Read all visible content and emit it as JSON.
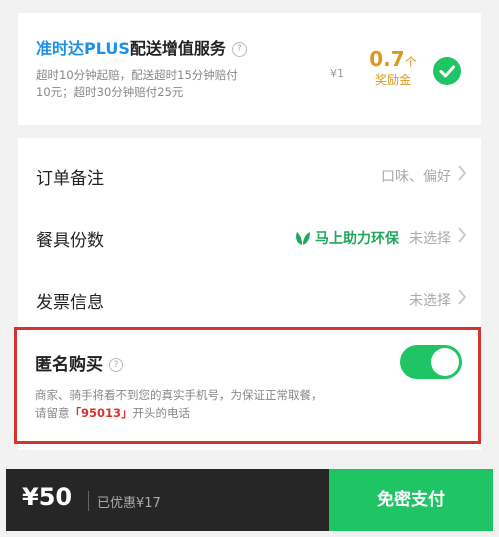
{
  "plus_service": {
    "brand": "准时达PLUS",
    "title": "配送增值服务",
    "desc_line1": "超时10分钟起赔，配送超时15分钟赔付",
    "desc_line2": "10元；超时30分钟赔付25元",
    "price": "¥1",
    "bonus_value": "0.7",
    "bonus_unit": "个",
    "bonus_label": "奖励金",
    "selected": true
  },
  "rows": [
    {
      "label": "订单备注",
      "value": "口味、偏好"
    },
    {
      "label": "餐具份数",
      "eco_label": "马上助力环保",
      "value": "未选择"
    },
    {
      "label": "发票信息",
      "value": "未选择"
    }
  ],
  "anonymous": {
    "title": "匿名购买",
    "desc_line1": "商家、骑手将看不到您的真实手机号，为保证正常取餐，",
    "desc_prefix": "请留意",
    "desc_highlight": "「95013」",
    "desc_suffix": "开头的电话",
    "enabled": true
  },
  "bottom_bar": {
    "total": "¥50",
    "discount": "已优惠¥17",
    "pay_label": "免密支付"
  },
  "colors": {
    "accent_green": "#1fc464",
    "brand_blue": "#1e90e8",
    "bonus_gold": "#d79a1a",
    "highlight_red": "#d8322e"
  }
}
